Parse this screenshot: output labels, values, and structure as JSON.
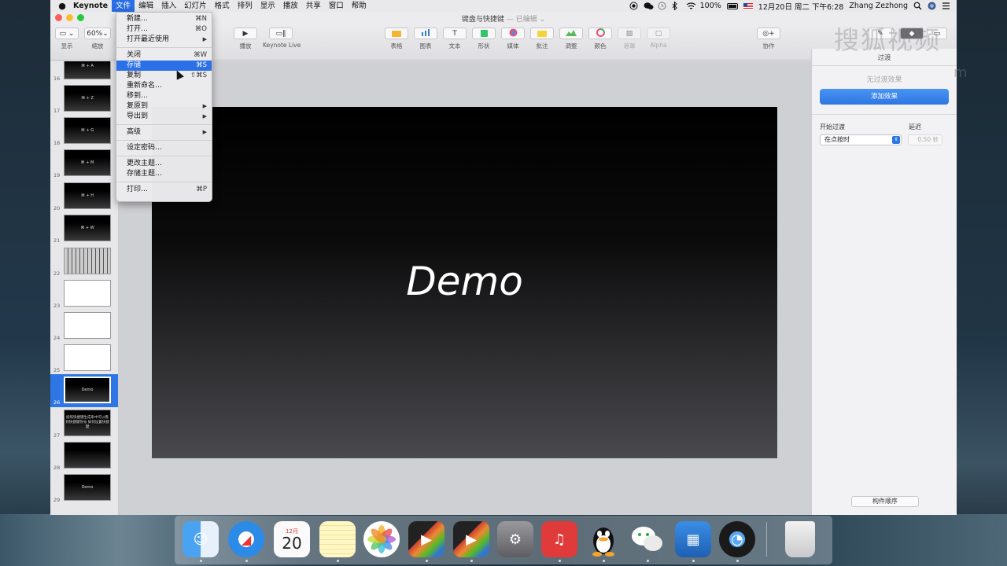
{
  "menubar": {
    "apple": "",
    "app_name": "Keynote",
    "items": [
      "文件",
      "编辑",
      "插入",
      "幻灯片",
      "格式",
      "排列",
      "显示",
      "播放",
      "共享",
      "窗口",
      "帮助"
    ],
    "battery": "100%",
    "date": "12月20日 周二 下午6:28",
    "user": "Zhang Zezhong"
  },
  "window": {
    "doc_name": "键盘与快捷键",
    "doc_status": "— 已编辑 ⌄"
  },
  "toolbar": {
    "view_label": "显示",
    "zoom_value": "60%",
    "zoom_label": "缩放",
    "play_label": "播放",
    "keynote_live_label": "Keynote Live",
    "table_label": "表格",
    "chart_label": "图表",
    "text_label": "文本",
    "shape_label": "形状",
    "media_label": "媒体",
    "comment_label": "批注",
    "adjust_label": "调整",
    "color_label": "颜色",
    "mask_label": "遮罩",
    "alpha_label": "Alpha",
    "collab_label": "协作"
  },
  "file_menu": {
    "new": "新建…",
    "new_sc": "⌘N",
    "open": "打开…",
    "open_sc": "⌘O",
    "open_recent": "打开最近使用",
    "close": "关闭",
    "close_sc": "⌘W",
    "save": "存储",
    "save_sc": "⌘S",
    "duplicate": "复制",
    "duplicate_sc": "⇧⌘S",
    "rename": "重新命名…",
    "move_to": "移到…",
    "revert_to": "复原到",
    "export_to": "导出到",
    "advanced": "高级",
    "set_password": "设定密码…",
    "change_theme": "更改主题…",
    "save_theme": "存储主题…",
    "print": "打印…",
    "print_sc": "⌘P",
    "submenu_arrow": "▶"
  },
  "navigator": {
    "slides": [
      {
        "num": "16",
        "label": "⌘ + A"
      },
      {
        "num": "17",
        "label": "⌘ + Z"
      },
      {
        "num": "18",
        "label": "⌘ + G"
      },
      {
        "num": "19",
        "label": "⌘ + M"
      },
      {
        "num": "20",
        "label": "⌘ + H"
      },
      {
        "num": "21",
        "label": "⌘ + W"
      },
      {
        "num": "22",
        "label": ""
      },
      {
        "num": "23",
        "label": ""
      },
      {
        "num": "24",
        "label": ""
      },
      {
        "num": "25",
        "label": ""
      },
      {
        "num": "26",
        "label": "Demo"
      },
      {
        "num": "27",
        "label": "按照快捷键生成串中可以看到快捷键符号 如何设置快捷键"
      },
      {
        "num": "28",
        "label": ""
      },
      {
        "num": "29",
        "label": "Demo"
      }
    ]
  },
  "slide": {
    "text": "Demo"
  },
  "inspector": {
    "tab": "过渡",
    "no_effect": "无过渡效果",
    "add_effect": "添加效果",
    "start_label": "开始过渡",
    "delay_label": "延迟",
    "start_value": "在点按时",
    "delay_value": "0.50 秒",
    "order_button": "构件顺序"
  },
  "watermark": {
    "text": "搜狐视频",
    "small": "m"
  },
  "dock": {
    "calendar_month": "12月",
    "calendar_day": "20"
  }
}
